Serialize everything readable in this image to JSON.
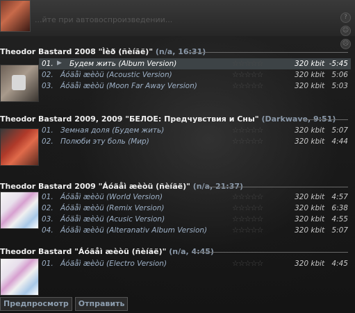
{
  "top_bar": {
    "text": "...йте при автовоспроизведении...",
    "icons": [
      "help-icon",
      "smile-icon",
      "sad-icon",
      "close-icon"
    ]
  },
  "albums": [
    {
      "title": "Theodor Bastard 2008 \"Ìèð (ñèíãë)\"",
      "meta": "(n/a, 16:31)",
      "tracks": [
        {
          "num": "01.",
          "title": "Будем жить (Album Version)",
          "kbit": "320 kbit",
          "dur": "-5:45",
          "active": true
        },
        {
          "num": "02.",
          "title": "Áóäåì æèòü (Acoustic Version)",
          "kbit": "320 kbit",
          "dur": "5:06"
        },
        {
          "num": "03.",
          "title": "Áóäåì æèòü (Moon Far Away Version)",
          "kbit": "320 kbit",
          "dur": "5:03"
        }
      ]
    },
    {
      "title": "Theodor Bastard 2009, 2009 \"БЕЛОЕ: Предчувствия и Сны\"",
      "meta": "(Darkwave, 9:51)",
      "tracks": [
        {
          "num": "01.",
          "title": "Земная доля (Будем жить)",
          "kbit": "320 kbit",
          "dur": "5:07"
        },
        {
          "num": "02.",
          "title": "Полюби эту боль (Мир)",
          "kbit": "320 kbit",
          "dur": "4:44"
        }
      ]
    },
    {
      "title": "Theodor Bastard 2009 \"Áóäåì æèòü (ñèíãë)\"",
      "meta": "(n/a, 21:37)",
      "tracks": [
        {
          "num": "01.",
          "title": "Áóäåì æèòü (World Version)",
          "kbit": "320 kbit",
          "dur": "4:57"
        },
        {
          "num": "02.",
          "title": "Áóäåì æèòü (Remix Version)",
          "kbit": "320 kbit",
          "dur": "6:38"
        },
        {
          "num": "03.",
          "title": "Áóäåì æèòü (Acusic Version)",
          "kbit": "320 kbit",
          "dur": "4:55"
        },
        {
          "num": "04.",
          "title": "Áóäåì æèòü (Alteranativ Album Version)",
          "kbit": "320 kbit",
          "dur": "5:07"
        }
      ]
    },
    {
      "title": "Theodor Bastard  \"Áóäåì æèòü (ñèíãë)\"",
      "meta": "(n/a, 4:45)",
      "tracks": [
        {
          "num": "01.",
          "title": "Áóäåì æèòü (Electro Version)",
          "kbit": "320 kbit",
          "dur": "4:45"
        }
      ]
    }
  ],
  "rating_stars": "☆☆☆☆☆",
  "bottom_buttons": {
    "preview": "Предпросмотр",
    "send": "Отправить"
  },
  "colors": {
    "accent": "#9fb2c8",
    "meta": "#8a98a8",
    "active_row": "#3d4346"
  }
}
